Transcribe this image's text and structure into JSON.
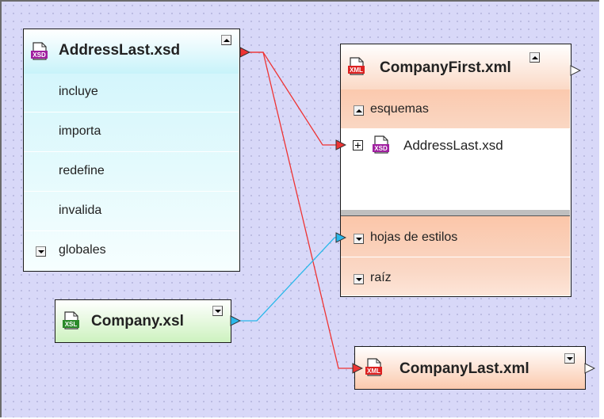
{
  "nodes": {
    "address_last": {
      "title": "AddressLast.xsd",
      "icon": "xsd-file-icon",
      "rows": [
        "incluye",
        "importa",
        "redefine",
        "invalida",
        "globales"
      ]
    },
    "company_xsl": {
      "title": "Company.xsl",
      "icon": "xsl-file-icon"
    },
    "company_first": {
      "title": "CompanyFirst.xml",
      "icon": "xml-file-icon",
      "section_schemas": "esquemas",
      "child_file": "AddressLast.xsd",
      "section_stylesheets": "hojas de estilos",
      "section_root": "raíz"
    },
    "company_last": {
      "title": "CompanyLast.xml",
      "icon": "xml-file-icon"
    }
  },
  "colors": {
    "canvas": "#d8d8f8",
    "schema_connector": "#ee3333",
    "xsl_connector": "#2ab8ea",
    "xsd_header": "#cff5fb",
    "xsl_header": "#d8f6cc",
    "xml_header": "#f8ccb4"
  }
}
